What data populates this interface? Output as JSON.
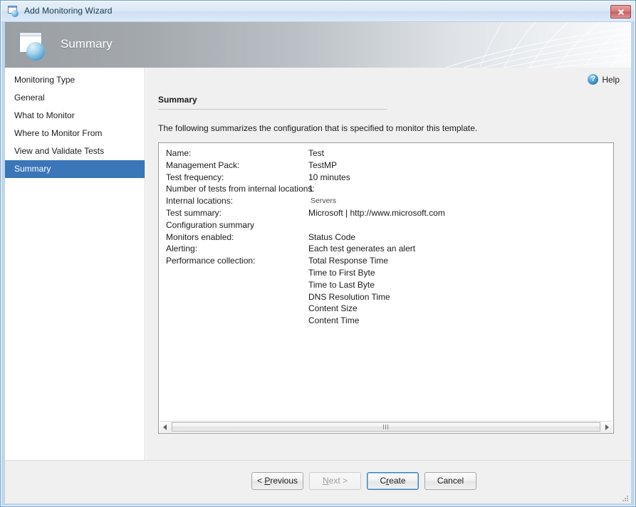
{
  "window": {
    "title": "Add Monitoring Wizard",
    "title_icon": "wizard-window-globe-icon",
    "close_label": "Close",
    "frame_color": "#bfd6ec"
  },
  "banner": {
    "title": "Summary",
    "icon": "page-globe-icon"
  },
  "sidebar": {
    "items": [
      {
        "label": "Monitoring Type",
        "selected": false
      },
      {
        "label": "General",
        "selected": false
      },
      {
        "label": "What to Monitor",
        "selected": false
      },
      {
        "label": "Where to Monitor From",
        "selected": false
      },
      {
        "label": "View and Validate Tests",
        "selected": false
      },
      {
        "label": "Summary",
        "selected": true
      }
    ],
    "selected_color": "#3a76b8"
  },
  "content": {
    "help_label": "Help",
    "help_icon": "help-question-icon",
    "section_title": "Summary",
    "intro_text": "The following summarizes the configuration that is specified to monitor this template.",
    "rows": [
      {
        "label": "Name:",
        "value": "Test",
        "style": "normal"
      },
      {
        "label": "Management Pack:",
        "value": "TestMP",
        "style": "normal"
      },
      {
        "label": "Test frequency:",
        "value": "10 minutes",
        "style": "normal"
      },
      {
        "label": "Number of tests from internal locations:",
        "value": "1",
        "style": "normal"
      },
      {
        "label": "Internal locations:",
        "value": "Servers",
        "style": "small"
      },
      {
        "label": "Test summary:",
        "value": "Microsoft | http://www.microsoft.com",
        "style": "normal"
      },
      {
        "label": "Configuration summary",
        "value": "",
        "style": "normal"
      },
      {
        "label": "Monitors enabled:",
        "value": "Status Code",
        "style": "normal"
      },
      {
        "label": "Alerting:",
        "value": "Each test generates an alert",
        "style": "normal"
      },
      {
        "label": "Performance collection:",
        "value": "Total Response Time",
        "style": "normal"
      },
      {
        "label": "",
        "value": "Time to First Byte",
        "style": "normal"
      },
      {
        "label": "",
        "value": "Time to Last Byte",
        "style": "normal"
      },
      {
        "label": "",
        "value": "DNS Resolution Time",
        "style": "normal"
      },
      {
        "label": "",
        "value": "Content Size",
        "style": "normal"
      },
      {
        "label": "",
        "value": "Content Time",
        "style": "normal"
      }
    ]
  },
  "scrollbar": {
    "left_arrow": "scroll-left-arrow-icon",
    "right_arrow": "scroll-right-arrow-icon"
  },
  "footer": {
    "buttons": [
      {
        "id": "previous",
        "label": "< Previous",
        "pre": "< ",
        "accel": "P",
        "post": "revious",
        "state": "enabled"
      },
      {
        "id": "next",
        "label": "Next >",
        "pre": "",
        "accel": "N",
        "post": "ext >",
        "state": "disabled"
      },
      {
        "id": "create",
        "label": "Create",
        "pre": "C",
        "accel": "r",
        "post": "eate",
        "state": "focused"
      },
      {
        "id": "cancel",
        "label": "Cancel",
        "pre": "Cancel",
        "accel": "",
        "post": "",
        "state": "enabled"
      }
    ]
  }
}
